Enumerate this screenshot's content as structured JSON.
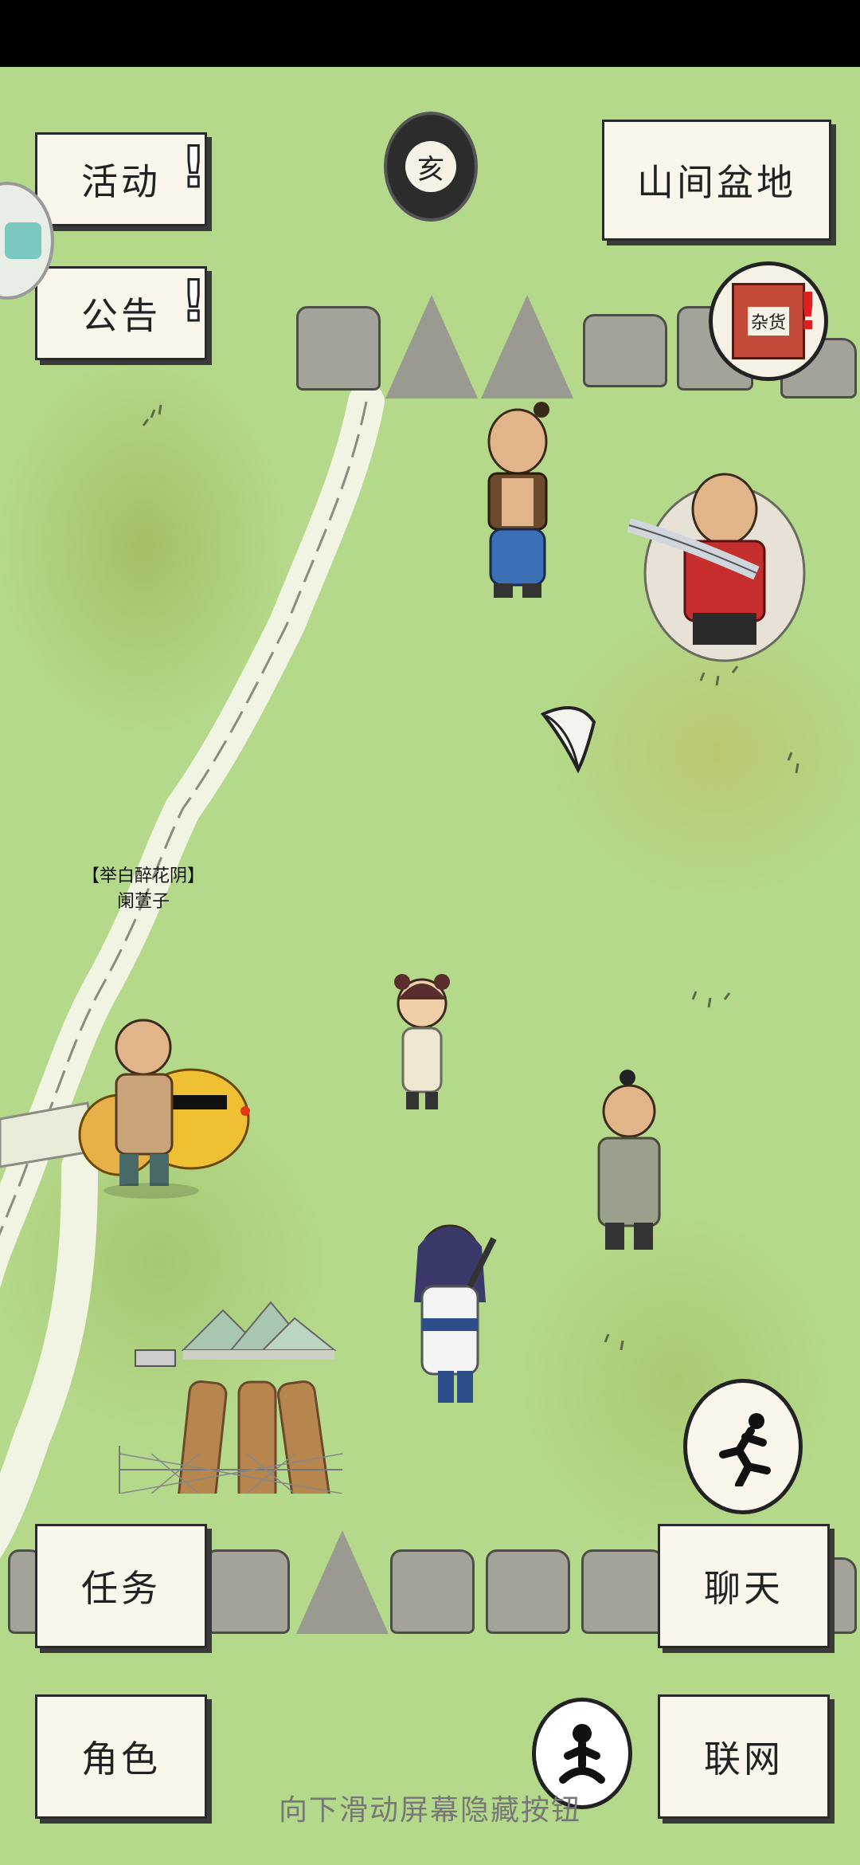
{
  "buttons": {
    "activity": "活动",
    "notice": "公告",
    "location": "山间盆地",
    "task": "任务",
    "chat": "聊天",
    "role": "角色",
    "network": "联网"
  },
  "badges": {
    "activity_alert": "!",
    "notice_alert": "!",
    "shop_alert": "!"
  },
  "time_icon_char": "亥",
  "shop_sign": "杂货",
  "npc": {
    "title": "【举白醉花阴】",
    "name": "阑萱子"
  },
  "hint": "向下滑动屏幕隐藏按钮",
  "icons": [
    "time-icon",
    "shop-icon",
    "leaf-icon",
    "run-icon",
    "meditate-icon",
    "side-tab-icon"
  ],
  "colors": {
    "grass": "#b4d98a",
    "alert_red": "#e02020"
  }
}
